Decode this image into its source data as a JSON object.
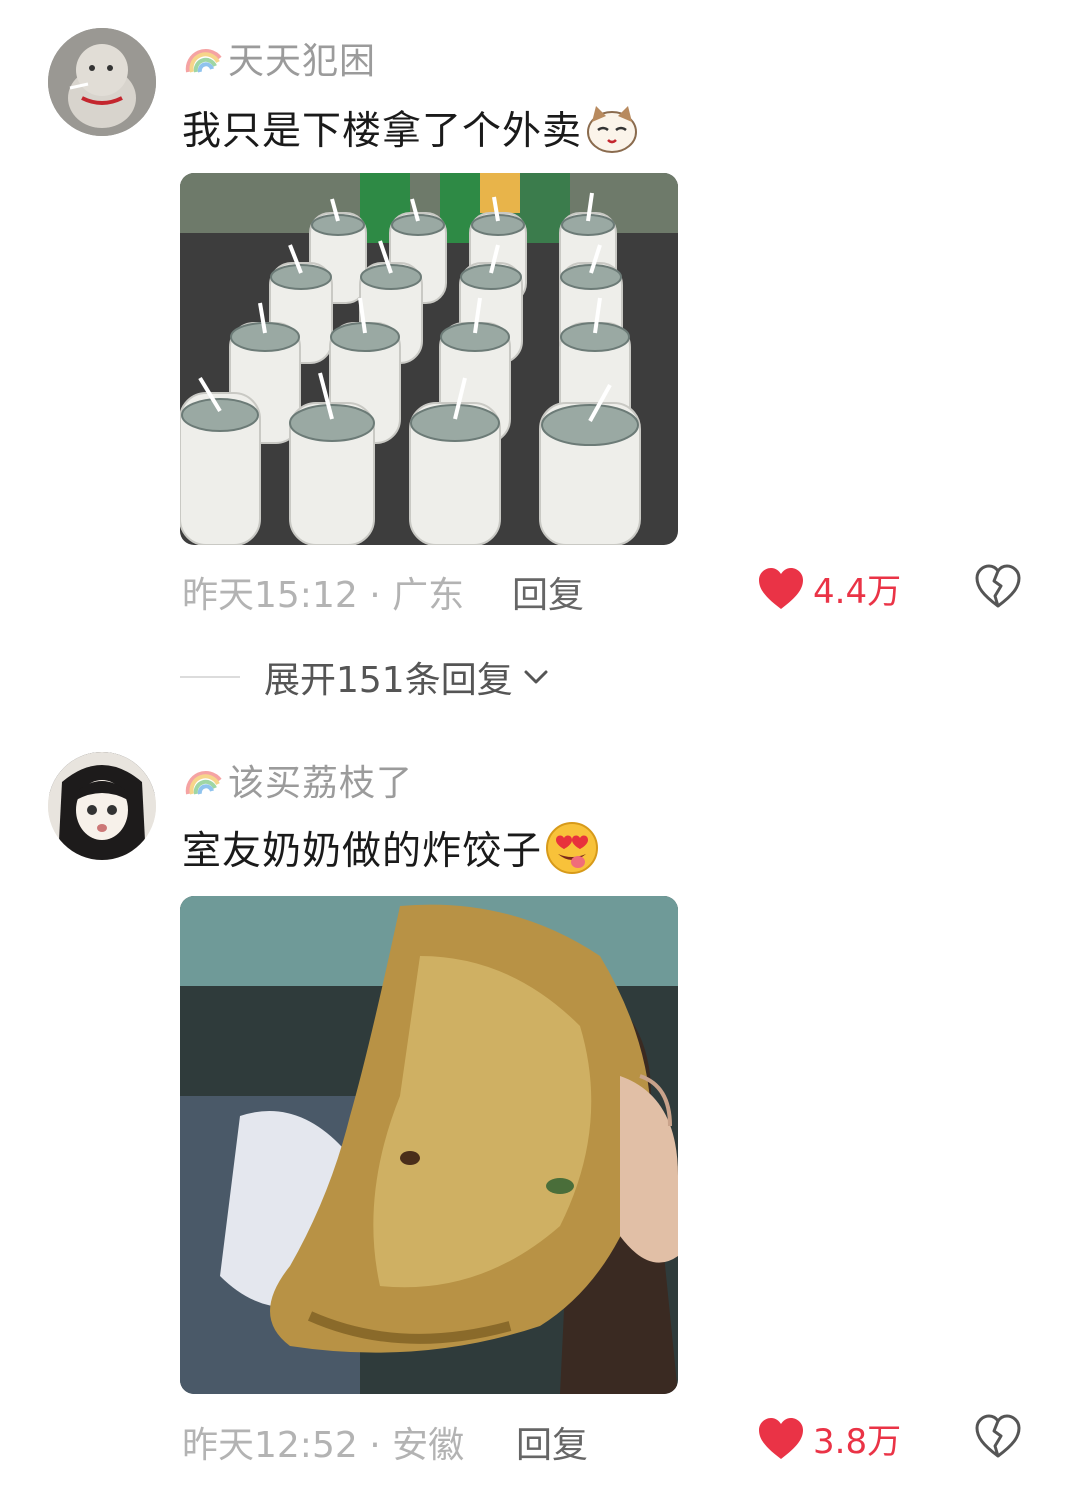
{
  "comments": [
    {
      "username": "天天犯困",
      "text": "我只是下楼拿了个外卖",
      "emoji": "cat-face-emoji",
      "photo": "yogurt-bottles-photo",
      "time_location": "昨天15:12 · 广东",
      "reply_label": "回复",
      "likes": "4.4万",
      "expand_label": "展开151条回复"
    },
    {
      "username": "该买荔枝了",
      "text": "室友奶奶做的炸饺子",
      "emoji": "heart-eyes-tongue-emoji",
      "photo": "fried-dumpling-photo",
      "time_location": "昨天12:52 · 安徽",
      "reply_label": "回复",
      "likes": "3.8万"
    }
  ],
  "colors": {
    "like_red": "#ea3346",
    "meta_gray": "#b3b3b3",
    "username_gray": "#9b9b9b"
  }
}
